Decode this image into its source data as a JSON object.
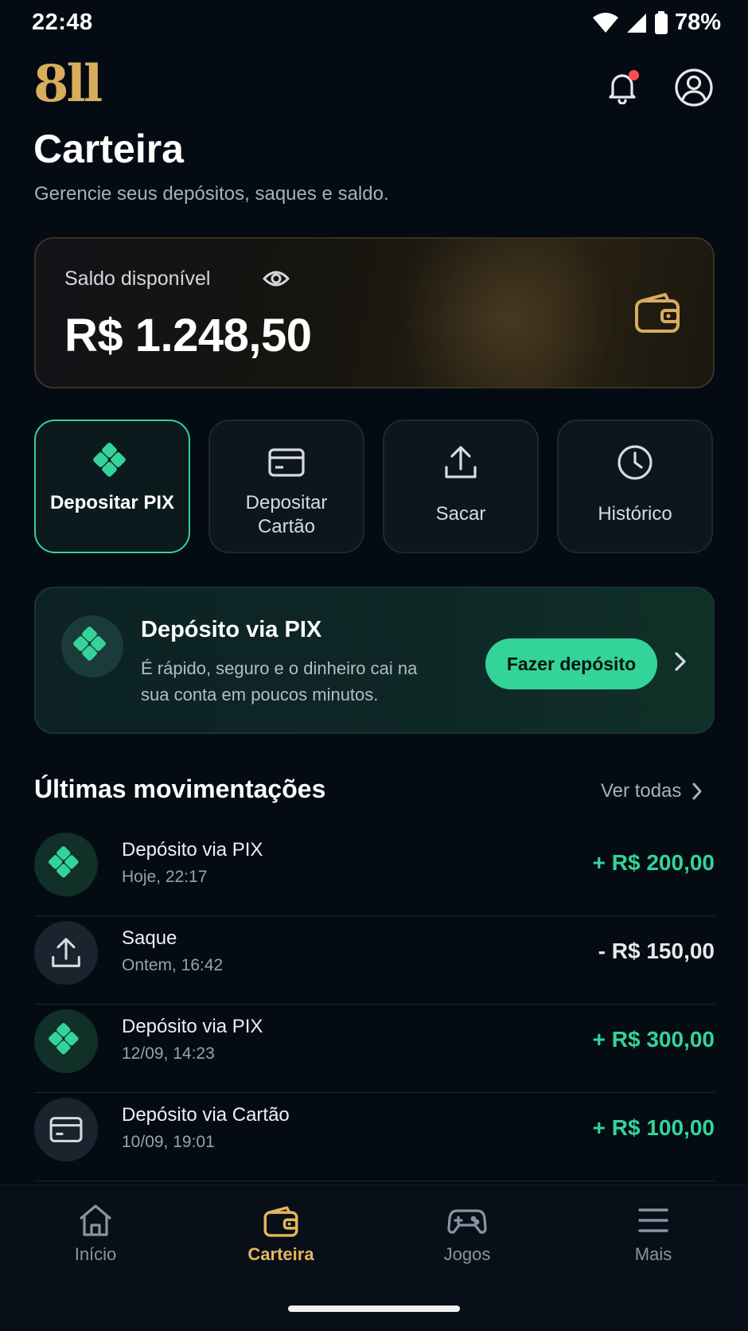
{
  "status_bar": {
    "time": "22:48",
    "battery": "78%"
  },
  "header": {
    "logo": "8ll",
    "title": "Carteira",
    "subtitle": "Gerencie seus depósitos, saques e saldo."
  },
  "balance": {
    "label": "Saldo disponível",
    "value": "R$ 1.248,50"
  },
  "actions": [
    {
      "label": "Depositar PIX",
      "icon": "pix-icon",
      "active": true
    },
    {
      "label": "Depositar Cartão",
      "icon": "card-icon",
      "active": false
    },
    {
      "label": "Sacar",
      "icon": "upload-icon",
      "active": false
    },
    {
      "label": "Histórico",
      "icon": "clock-icon",
      "active": false
    }
  ],
  "pix_banner": {
    "title": "Depósito via PIX",
    "description": "É rápido, seguro e o dinheiro cai na sua conta em poucos minutos.",
    "cta": "Fazer depósito"
  },
  "transactions": {
    "title": "Últimas movimentações",
    "see_all": "Ver todas",
    "items": [
      {
        "title": "Depósito via PIX",
        "date": "Hoje, 22:17",
        "amount": "+ R$ 200,00",
        "icon": "pix-icon",
        "type": "positive"
      },
      {
        "title": "Saque",
        "date": "Ontem, 16:42",
        "amount": "- R$ 150,00",
        "icon": "upload-icon",
        "type": "negative"
      },
      {
        "title": "Depósito via PIX",
        "date": "12/09, 14:23",
        "amount": "+ R$ 300,00",
        "icon": "pix-icon",
        "type": "positive"
      },
      {
        "title": "Depósito via Cartão",
        "date": "10/09, 19:01",
        "amount": "+ R$ 100,00",
        "icon": "card-icon",
        "type": "positive"
      }
    ]
  },
  "nav": {
    "items": [
      {
        "label": "Início",
        "icon": "home-icon"
      },
      {
        "label": "Carteira",
        "icon": "wallet-icon",
        "active": true
      },
      {
        "label": "Jogos",
        "icon": "gamepad-icon"
      },
      {
        "label": "Mais",
        "icon": "menu-icon"
      }
    ]
  },
  "colors": {
    "accent_green": "#34d399",
    "accent_gold": "#e7b65a",
    "background": "#050b13"
  }
}
